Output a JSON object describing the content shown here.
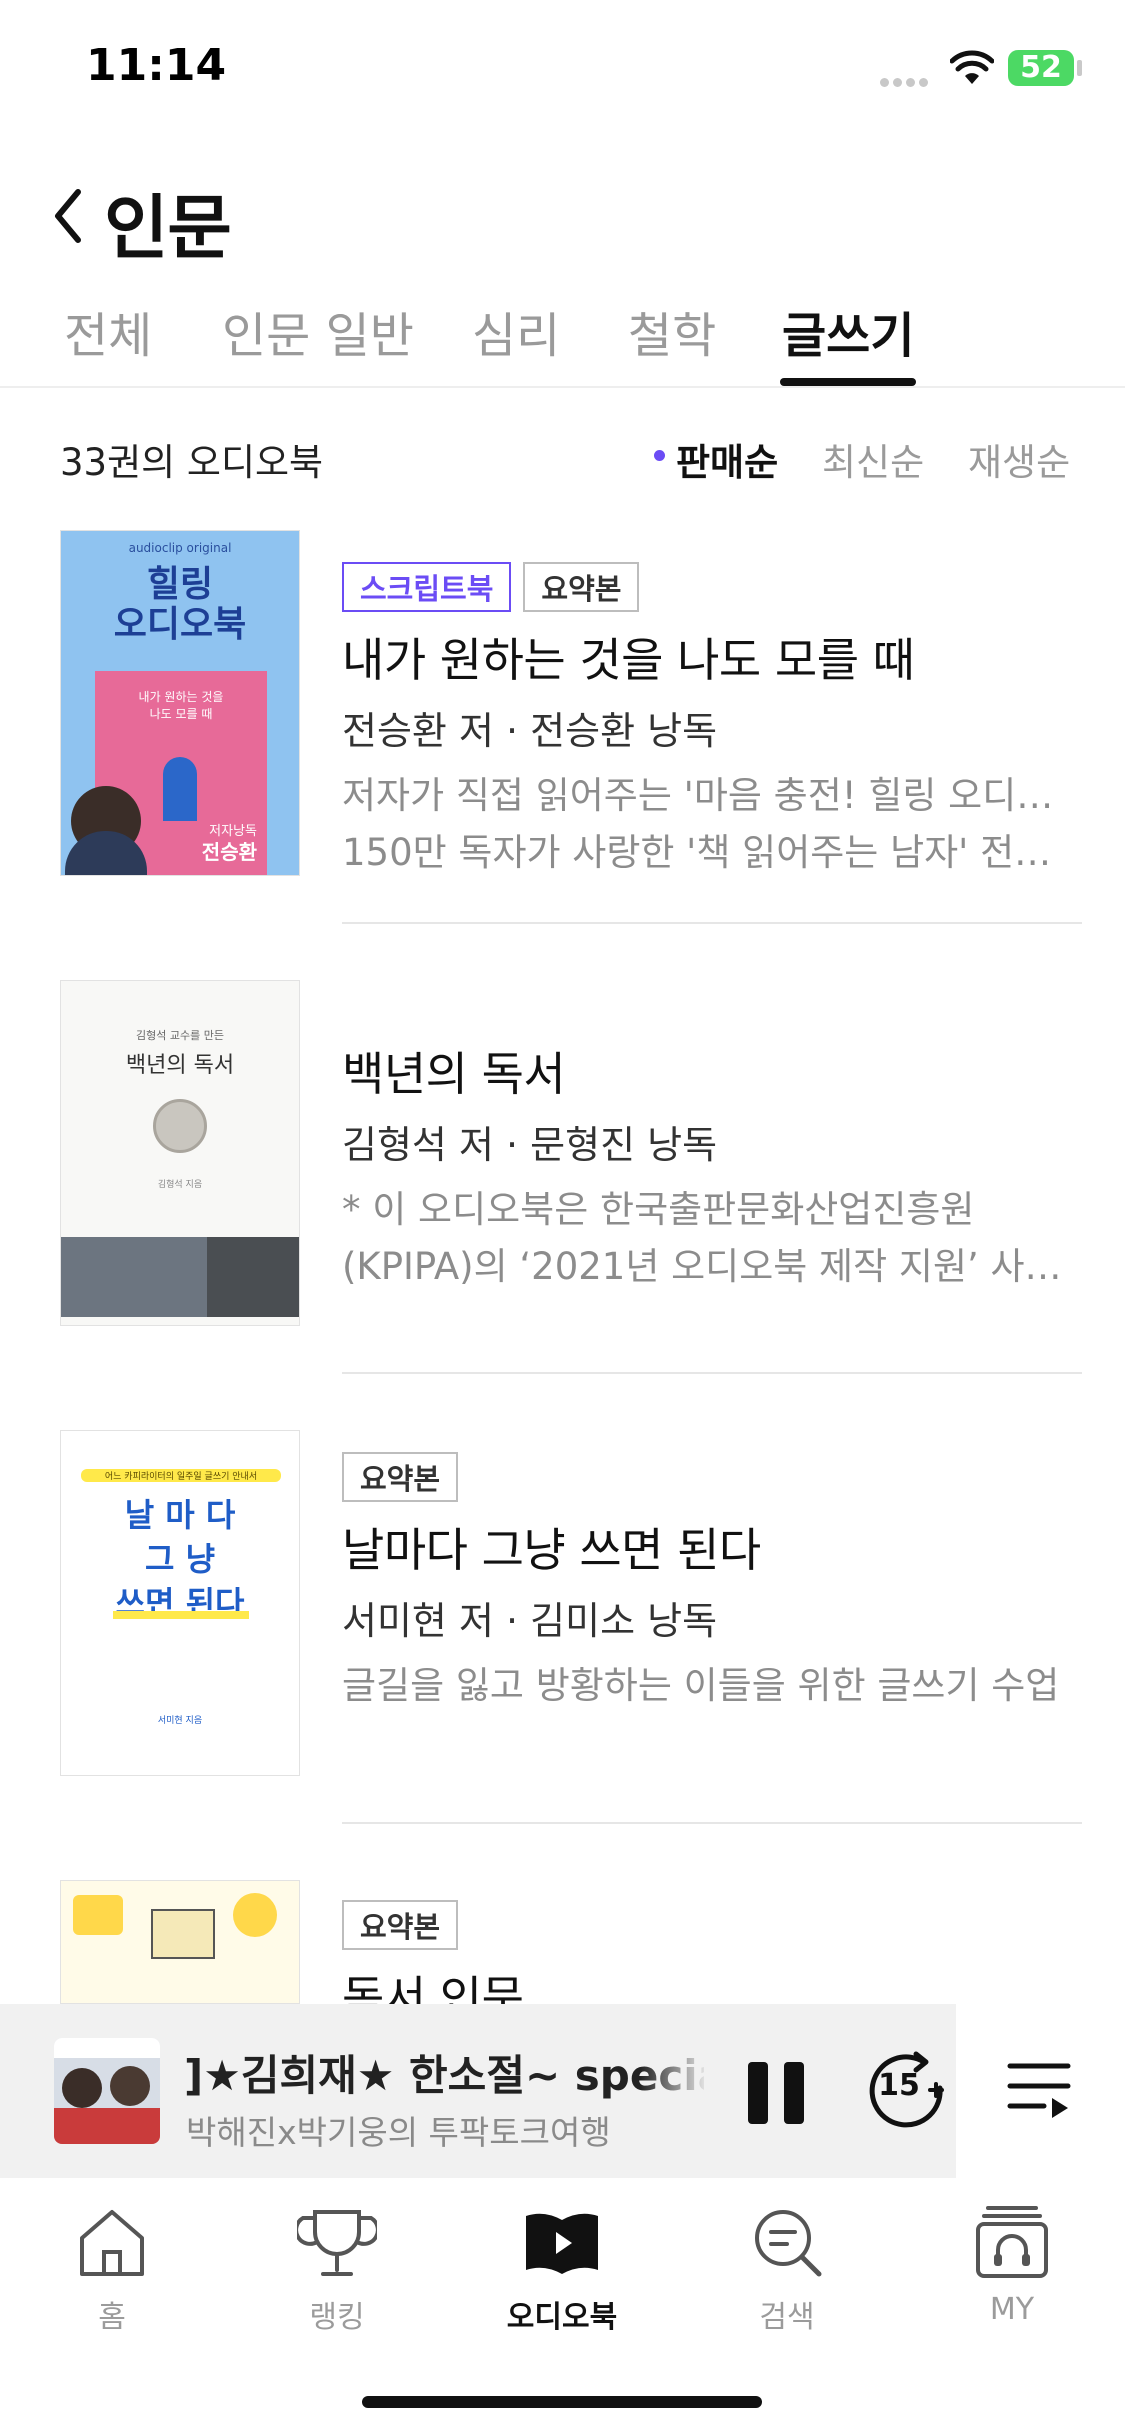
{
  "status_bar": {
    "time": "11:14",
    "battery": "52"
  },
  "header": {
    "title": "인문"
  },
  "tabs": [
    {
      "label": "전체"
    },
    {
      "label": "인문 일반"
    },
    {
      "label": "심리"
    },
    {
      "label": "철학"
    },
    {
      "label": "글쓰기",
      "active": true
    }
  ],
  "list_header": {
    "count": "33권의 오디오북",
    "sort_options": [
      "판매순",
      "최신순",
      "재생순"
    ],
    "sort_selected": "판매순"
  },
  "books": [
    {
      "badges": [
        "스크립트북",
        "요약본"
      ],
      "title": "내가 원하는 것을 나도 모를 때",
      "author": "전승환 저 · 전승환 낭독",
      "desc1": "저자가 직접 읽어주는 '마음 충전! 힐링 오디오북'",
      "desc2": "150만 독자가 사랑한 '책 읽어주는 남자' 전승…",
      "cover": {
        "brand": "audioclip original",
        "line1": "힐링",
        "line2": "오디오북",
        "sub1": "내가 원하는 것을",
        "sub2": "나도 모를 때",
        "tag": "저자낭독",
        "name": "전승환"
      }
    },
    {
      "badges": [],
      "title": "백년의 독서",
      "author": "김형석 저 · 문형진 낭독",
      "desc1": "* 이 오디오북은 한국출판문화산업진흥원",
      "desc2": "(KPIPA)의 ‘2021년 오디오북 제작 지원’ 사업…",
      "cover": {
        "top": "김형석 교수를 만든",
        "title": "백년의 독서",
        "author": "김형석 지음"
      }
    },
    {
      "badges": [
        "요약본"
      ],
      "title": "날마다 그냥 쓰면 된다",
      "author": "서미현 저 · 김미소 낭독",
      "desc1": "글길을 잃고 방황하는 이들을 위한 글쓰기 수업",
      "desc2": "",
      "cover": {
        "top": "어느 카피라이터의 일주일 글쓰기 안내서",
        "l1": "날 마 다",
        "l2": "그   냥",
        "l3": "쓰면 된다",
        "author": "서미현 지음"
      }
    },
    {
      "badges": [
        "요약본"
      ],
      "title": "독서 인문",
      "author": "",
      "desc1": "",
      "desc2": ""
    }
  ],
  "mini_player": {
    "title": "]★김희재★ 한소절~ special",
    "subtitle": "박해진x박기웅의 투팍토크여행",
    "skip_label": "15"
  },
  "bottom_nav": [
    {
      "label": "홈",
      "icon": "home-icon"
    },
    {
      "label": "랭킹",
      "icon": "trophy-icon"
    },
    {
      "label": "오디오북",
      "icon": "audiobook-icon",
      "active": true
    },
    {
      "label": "검색",
      "icon": "search-icon"
    },
    {
      "label": "MY",
      "icon": "my-library-icon"
    }
  ],
  "colors": {
    "accent": "#6b4cf5",
    "battery": "#4cd964"
  }
}
